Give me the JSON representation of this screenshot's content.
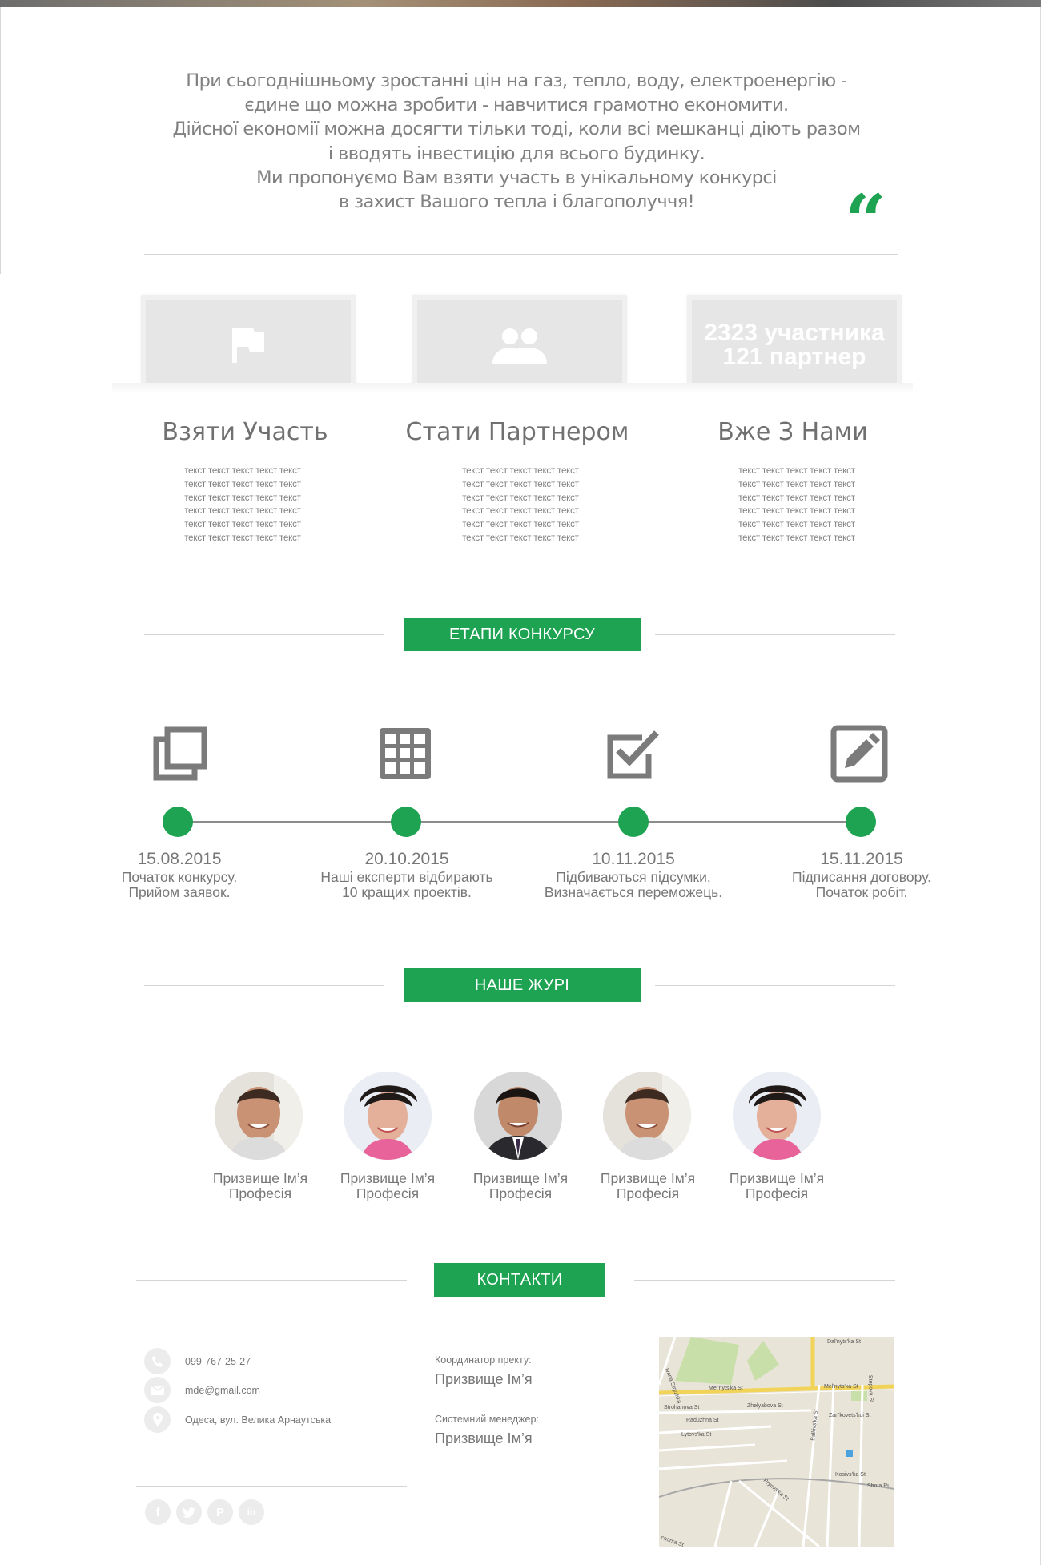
{
  "intro": {
    "lines": [
      "При сьогоднішньому зростанні цін на газ, тепло, воду, електроенергію -",
      "єдине що можна зробити - навчитися грамотно економити.",
      "Дійсної економії можна досягти тільки тоді, коли всі мешканці діють разом",
      "і вводять інвестицію для всього будинку.",
      "Ми пропонуємо Вам взяти участь в унікальному конкурсі",
      "в захист Вашого тепла і благополуччя!"
    ],
    "quote_mark": "“"
  },
  "cards": [
    {
      "icon": "flag-icon",
      "title": "Взяти Участь",
      "body": "текст текст текст текст текст текст текст текст текст текст текст текст текст текст текст текст текст текст текст текст текст текст текст текст текст текст текст текст текст текст"
    },
    {
      "icon": "people-icon",
      "title": "Стати Партнером",
      "body": "текст текст текст текст текст текст текст текст текст текст текст текст текст текст текст текст текст текст текст текст текст текст текст текст текст текст текст текст текст текст"
    },
    {
      "stat_line1": "2323 участника",
      "stat_line2": "121 партнер",
      "title": "Вже З Нами",
      "body": "текст текст текст текст текст текст текст текст текст текст текст текст текст текст текст текст текст текст текст текст текст текст текст текст текст текст текст текст текст текст"
    }
  ],
  "stages": {
    "heading": "ЕТАПИ КОНКУРСУ",
    "items": [
      {
        "icon": "copy-icon",
        "date": "15.08.2015",
        "line1": "Початок конкурсу.",
        "line2": "Прийом заявок."
      },
      {
        "icon": "grid-icon",
        "date": "20.10.2015",
        "line1": "Наші експерти відбирають",
        "line2": "10 кращих проектів."
      },
      {
        "icon": "checkbox-icon",
        "date": "10.11.2015",
        "line1": "Підбиваються підсумки,",
        "line2": "Визначається переможець."
      },
      {
        "icon": "edit-icon",
        "date": "15.11.2015",
        "line1": "Підписання договору.",
        "line2": "Початок робіт."
      }
    ]
  },
  "jury": {
    "heading": "НАШЕ ЖУРІ",
    "members": [
      {
        "name": "Призвище Ім’я",
        "role": "Професія"
      },
      {
        "name": "Призвище Ім’я",
        "role": "Професія"
      },
      {
        "name": "Призвище Ім’я",
        "role": "Професія"
      },
      {
        "name": "Призвище Ім’я",
        "role": "Професія"
      },
      {
        "name": "Призвище Ім’я",
        "role": "Професія"
      }
    ]
  },
  "contacts": {
    "heading": "КОНТАКТИ",
    "phone": "099-767-25-27",
    "email": "mde@gmail.com",
    "address": "Одеса, вул. Велика Арнаутська",
    "coordinator_label": "Координатор пректу:",
    "coordinator_name": "Призвище Ім’я",
    "manager_label": "Системний менеджер:",
    "manager_name": "Призвище Ім’я",
    "social": [
      "facebook-icon",
      "twitter-icon",
      "pinterest-icon",
      "linkedin-icon"
    ]
  },
  "map": {
    "streets": [
      "Dal'nyts'ka St",
      "Mel'nyts'ka St",
      "Mel'nyts'ka St",
      "Strohanova St",
      "Zhelyabova St",
      "Raduzhna St",
      "Lytovs'ka St",
      "Zan'kovets'koi St",
      "Kosivs'ka St",
      "Shota Ru",
      "Prymis'ka St",
      "Balkivs'ka St",
      "Stepova St",
      "Ivana Stryzhka",
      "chorsa St"
    ]
  },
  "colors": {
    "accent": "#1ea352",
    "text": "#777777"
  }
}
